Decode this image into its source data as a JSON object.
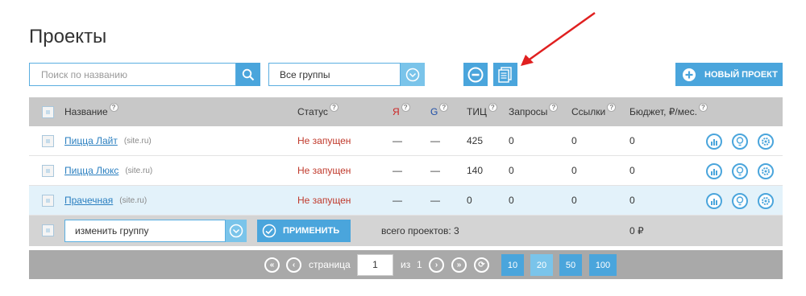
{
  "page_title": "Проекты",
  "search": {
    "placeholder": "Поиск по названию"
  },
  "group_filter": {
    "value": "Все группы"
  },
  "new_project_label": "НОВЫЙ ПРОЕКТ",
  "columns": {
    "name": "Название",
    "status": "Статус",
    "yandex": "Я",
    "google": "G",
    "tic": "ТИЦ",
    "queries": "Запросы",
    "links": "Ссылки",
    "budget": "Бюджет, ₽/мес.",
    "help": "?"
  },
  "rows": [
    {
      "name": "Пицца Лайт",
      "site": "(site.ru)",
      "status": "Не запущен",
      "yandex": "—",
      "google": "—",
      "tic": "425",
      "queries": "0",
      "links": "0",
      "budget": "0"
    },
    {
      "name": "Пицца Люкс",
      "site": "(site.ru)",
      "status": "Не запущен",
      "yandex": "—",
      "google": "—",
      "tic": "140",
      "queries": "0",
      "links": "0",
      "budget": "0"
    },
    {
      "name": "Прачечная",
      "site": "(site.ru)",
      "status": "Не запущен",
      "yandex": "—",
      "google": "—",
      "tic": "0",
      "queries": "0",
      "links": "0",
      "budget": "0"
    }
  ],
  "footer": {
    "change_group_value": "изменить группу",
    "apply_label": "ПРИМЕНИТЬ",
    "total_projects": "всего проектов: 3",
    "total_budget": "0 ₽"
  },
  "pager": {
    "page_label": "страница",
    "current_page": "1",
    "of_label": "из",
    "total_pages": "1",
    "sizes": [
      "10",
      "20",
      "50",
      "100"
    ],
    "active_size": "20"
  },
  "colors": {
    "accent": "#4aa5dc",
    "accent_light": "#7ac4ea",
    "status_red": "#c0392b",
    "highlight_row": "#e3f2fa"
  }
}
